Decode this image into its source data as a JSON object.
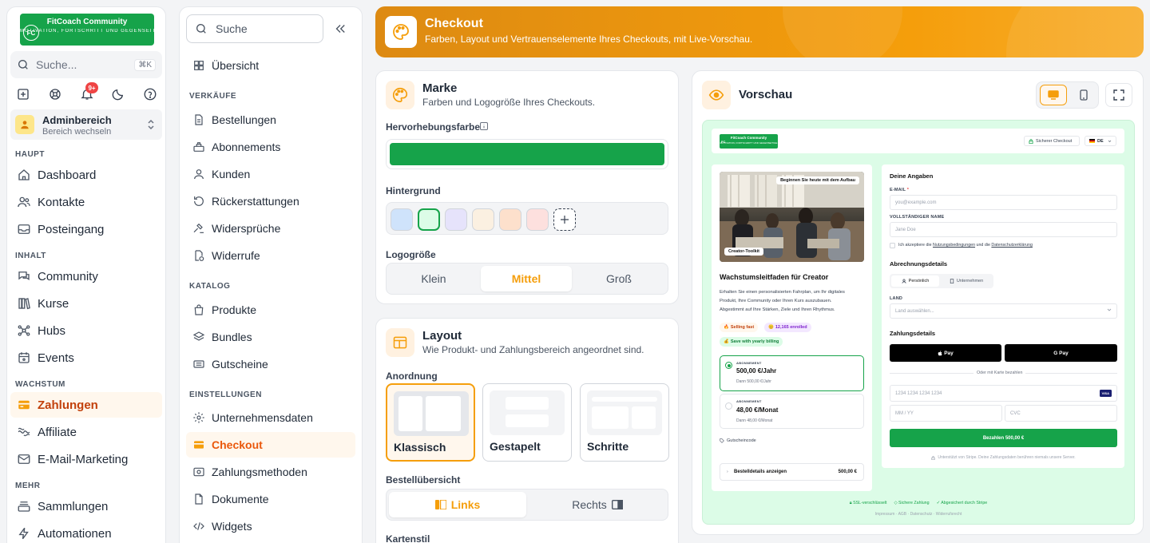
{
  "colors": {
    "accent": "#f59e0b",
    "brand": "#16a34a",
    "mint": "#dcfce7"
  },
  "brand": {
    "logo_initials": "FC",
    "name": "FitCoach Community",
    "tagline": "MOTIVATION, FORTSCHRITT UND GEGENSEITIGE"
  },
  "global_search": {
    "placeholder": "Suche...",
    "shortcut": "⌘K"
  },
  "notifications": {
    "badge": "9+"
  },
  "workspace": {
    "title": "Adminbereich",
    "subtitle": "Bereich wechseln"
  },
  "nav": {
    "sec_haupt": "HAUPT",
    "dashboard": "Dashboard",
    "kontakte": "Kontakte",
    "posteingang": "Posteingang",
    "sec_inhalt": "INHALT",
    "community": "Community",
    "kurse": "Kurse",
    "hubs": "Hubs",
    "events": "Events",
    "sec_wachstum": "WACHSTUM",
    "zahlungen": "Zahlungen",
    "affiliate": "Affiliate",
    "email": "E-Mail-Marketing",
    "sec_mehr": "MEHR",
    "sammlungen": "Sammlungen",
    "automationen": "Automationen"
  },
  "sub": {
    "search": "Suche",
    "overview": "Übersicht",
    "sec_verkaeufe": "VERKÄUFE",
    "bestellungen": "Bestellungen",
    "abonnements": "Abonnements",
    "kunden": "Kunden",
    "rueck": "Rückerstattungen",
    "widersprueche": "Widersprüche",
    "widerrufe": "Widerrufe",
    "sec_katalog": "KATALOG",
    "produkte": "Produkte",
    "bundles": "Bundles",
    "gutscheine": "Gutscheine",
    "sec_einst": "EINSTELLUNGEN",
    "unternehmen": "Unternehmensdaten",
    "checkout": "Checkout",
    "zahlungsmethoden": "Zahlungsmethoden",
    "dokumente": "Dokumente",
    "widgets": "Widgets"
  },
  "header": {
    "title": "Checkout",
    "subtitle": "Farben, Layout und Vertrauenselemente Ihres Checkouts, mit Live-Vorschau."
  },
  "marke": {
    "title": "Marke",
    "subtitle": "Farben und Logogröße Ihres Checkouts.",
    "accent_label": "Hervorhebungsfarbe",
    "accent_color": "#16a34a",
    "bg_label": "Hintergrund",
    "swatches": [
      "#cfe3fb",
      "#dcfce7",
      "#e6e3fb",
      "#fbf0e1",
      "#fde0cc",
      "#fde0de"
    ],
    "selected_swatch": 1,
    "logo_label": "Logogröße",
    "logo_options": [
      "Klein",
      "Mittel",
      "Groß"
    ],
    "logo_selected": 1
  },
  "layout": {
    "title": "Layout",
    "subtitle": "Wie Produkt- und Zahlungsbereich angeordnet sind.",
    "arrangement_label": "Anordnung",
    "options": [
      "Klassisch",
      "Gestapelt",
      "Schritte"
    ],
    "selected": 0,
    "summary_label": "Bestellübersicht",
    "summary_left": "Links",
    "summary_right": "Rechts",
    "card_style_label": "Kartenstil"
  },
  "preview": {
    "title": "Vorschau",
    "topbar": {
      "secure": "Sicherer Checkout",
      "lang": "DE"
    },
    "product": {
      "image_badge": "Beginnen Sie heute mit dem Aufbau",
      "image_tag": "Creator-Toolkit",
      "title": "Wachstumsleitfaden für Creator",
      "desc1": "Erhalten Sie einen personalisierten Fahrplan, um Ihr digitales",
      "desc2": "Produkt, Ihre Community oder Ihren Kurs auszubauen.",
      "desc3": "Abgestimmt auf Ihre Stärken, Ziele und Ihren Rhythmus.",
      "badge1": "Selling fast",
      "badge2": "12,165 enrolled",
      "badge3": "Save with yearly billing",
      "plan1_tag": "ABONNEMENT",
      "plan1_price": "500,00 €/Jahr",
      "plan1_sub": "Dann 500,00 €/Jahr",
      "plan2_tag": "ABONNEMENT",
      "plan2_price": "48,00 €/Monat",
      "plan2_sub": "Dann 48,00 €/Monat",
      "coupon": "Gutscheincode",
      "details": "Bestelldetails anzeigen",
      "total": "500,00 €"
    },
    "form": {
      "title": "Deine Angaben",
      "email_label": "E-MAIL",
      "required_mark": "*",
      "email_ph": "you@example.com",
      "name_label": "VOLLSTÄNDIGER NAME",
      "name_ph": "Jane Doe",
      "terms_1": "Ich akzeptiere die",
      "terms_link1": "Nutzungsbedingungen",
      "terms_2": "und die",
      "terms_link2": "Datenschutzerklärung",
      "billing_title": "Abrechnungsdetails",
      "personal": "Persönlich",
      "company": "Unternehmen",
      "country_label": "LAND",
      "country_ph": "Land auswählen...",
      "payment_title": "Zahlungsdetails",
      "apple_pay": "Pay",
      "google_pay": "G Pay",
      "or_card": "Oder mit Karte bezahlen",
      "card_ph": "1234 1234 1234 1234",
      "card_brand": "VISA",
      "exp_ph": "MM / YY",
      "cvc_ph": "CVC",
      "pay_button": "Bezahlen 500,00 €",
      "stripe_note": "Unterstützt von Stripe. Deine Zahlungsdaten berühren niemals unsere Server."
    },
    "footer": {
      "ssl": "SSL-verschlüsselt",
      "secure": "Sichere Zahlung",
      "stripe": "Abgesichert durch Stripe",
      "links": "Impressum · AGB · Datenschutz · Widerrufsrecht"
    }
  }
}
